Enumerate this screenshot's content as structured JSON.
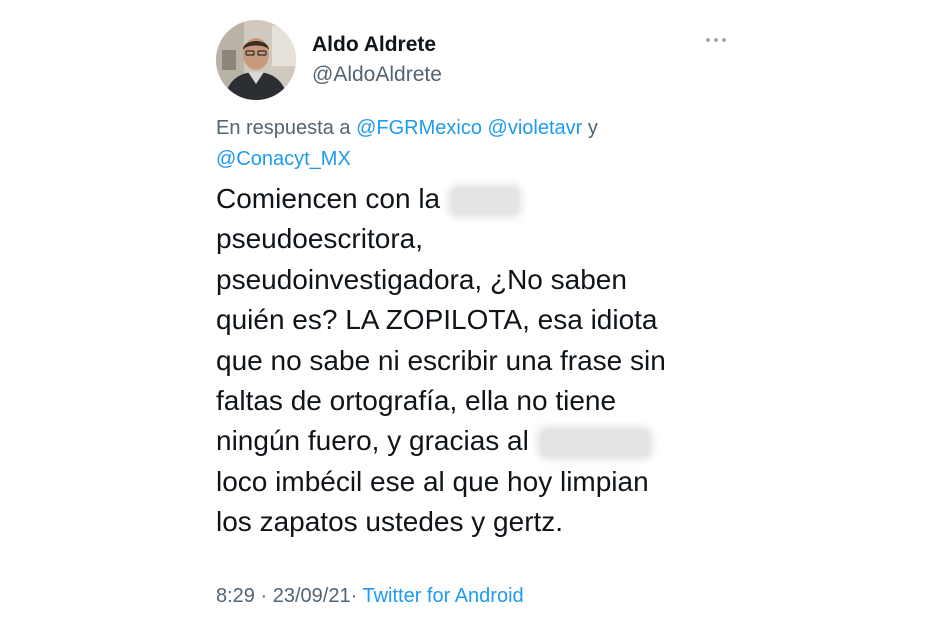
{
  "author": {
    "display_name": "Aldo Aldrete",
    "handle": "@AldoAldrete",
    "avatar": "user-avatar-photo"
  },
  "more_menu_icon": "more-horizontal-icon",
  "reply_context": {
    "prefix": "En respuesta a",
    "mentions": [
      "@FGRMexico",
      "@violetavr"
    ],
    "conjunction": "y",
    "last_mention": "@Conacyt_MX"
  },
  "tweet": {
    "lines": [
      "Comiencen con la",
      "pseudoescritora,",
      "pseudoinvestigadora, ¿No saben",
      "quién es? LA ZOPILOTA,  esa idiota",
      "que no sabe ni escribir una frase sin",
      "faltas de ortografía, ella no tiene",
      "ningún fuero, y gracias al",
      "loco imbécil ese al que hoy limpian",
      "los zapatos ustedes y gertz."
    ]
  },
  "meta": {
    "time": "8:29",
    "separator": "·",
    "date": "23/09/21",
    "source": "Twitter for Android"
  },
  "colors": {
    "text": "#0f1419",
    "secondary": "#536471",
    "link": "#1d9bf0",
    "background": "#ffffff"
  }
}
